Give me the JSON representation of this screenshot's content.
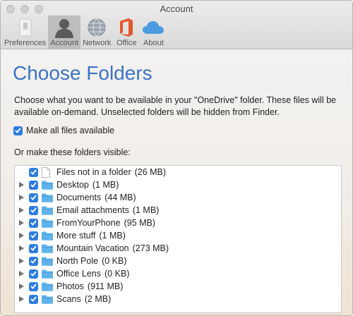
{
  "window": {
    "title": "Account"
  },
  "toolbar": {
    "items": [
      {
        "label": "Preferences",
        "icon": "switch-icon",
        "active": false
      },
      {
        "label": "Account",
        "icon": "person-icon",
        "active": true
      },
      {
        "label": "Network",
        "icon": "globe-icon",
        "active": false
      },
      {
        "label": "Office",
        "icon": "office-icon",
        "active": false
      },
      {
        "label": "About",
        "icon": "cloud-icon",
        "active": false
      }
    ]
  },
  "page": {
    "heading": "Choose Folders",
    "description": "Choose what you want to be available in your \"OneDrive\" folder. These files will be available on-demand. Unselected folders will be hidden from Finder.",
    "make_all_label": "Make all files available",
    "make_all_checked": true,
    "or_visible_label": "Or make these folders visible:"
  },
  "folders": [
    {
      "name": "Files not in a folder",
      "size": "(26 MB)",
      "type": "file",
      "expandable": false,
      "checked": true
    },
    {
      "name": "Desktop",
      "size": "(1 MB)",
      "type": "folder",
      "expandable": true,
      "checked": true
    },
    {
      "name": "Documents",
      "size": "(44 MB)",
      "type": "folder",
      "expandable": true,
      "checked": true
    },
    {
      "name": "Email attachments",
      "size": "(1 MB)",
      "type": "folder",
      "expandable": true,
      "checked": true
    },
    {
      "name": "FromYourPhone",
      "size": "(95 MB)",
      "type": "folder",
      "expandable": true,
      "checked": true
    },
    {
      "name": "More stuff",
      "size": "(1 MB)",
      "type": "folder",
      "expandable": true,
      "checked": true
    },
    {
      "name": "Mountain Vacation",
      "size": "(273 MB)",
      "type": "folder",
      "expandable": true,
      "checked": true
    },
    {
      "name": "North Pole",
      "size": "(0 KB)",
      "type": "folder",
      "expandable": true,
      "checked": true
    },
    {
      "name": "Office Lens",
      "size": "(0 KB)",
      "type": "folder",
      "expandable": true,
      "checked": true
    },
    {
      "name": "Photos",
      "size": "(911 MB)",
      "type": "folder",
      "expandable": true,
      "checked": true
    },
    {
      "name": "Scans",
      "size": "(2 MB)",
      "type": "folder",
      "expandable": true,
      "checked": true
    }
  ],
  "colors": {
    "accent": "#2d7de0",
    "heading": "#3a73c5",
    "folder": "#5fb3ea"
  }
}
